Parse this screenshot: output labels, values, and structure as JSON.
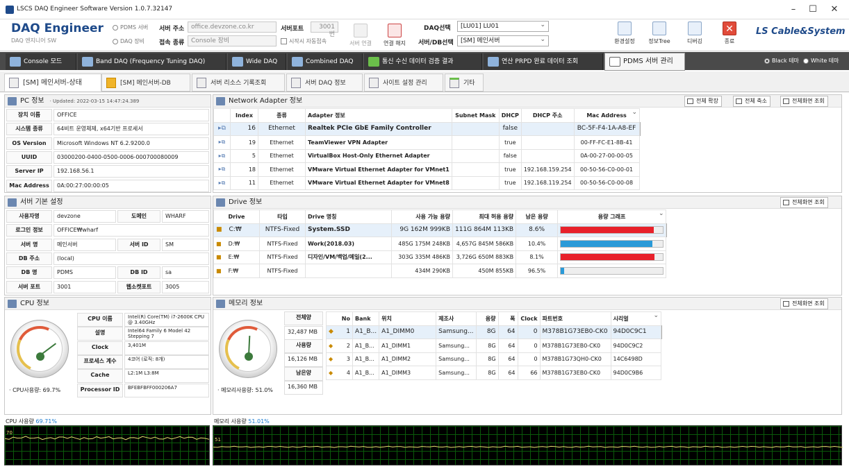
{
  "window": {
    "title": "LSCS DAQ Engineer Software Version 1.0.7.32147",
    "min": "–",
    "max": "☐",
    "close": "✕"
  },
  "toolbar": {
    "app_name": "DAQ Engineer",
    "app_sub": "DAQ 엔지니어 SW",
    "radio_pdms": "PDMS 서버",
    "radio_daq": "DAQ 장비",
    "server_addr_label": "서버 주소",
    "server_addr_value": "office.devzone.co.kr",
    "server_port_label": "서버포트",
    "server_port_value": "3001 번",
    "conn_type_label": "접속 종류",
    "conn_type_value": "Console 장비",
    "auto_connect": "시작시 자동접속",
    "connect_btn": "서버 연결",
    "disconnect_btn": "연결 해지",
    "daq_select_label": "DAQ선택",
    "daq_select_value": "[LU01] LU01",
    "server_db_label": "서버/DB선택",
    "server_db_value": "[SM] 메인서버",
    "env_btn": "환경설정",
    "info_tree_btn": "정보Tree",
    "debug_btn": "디버깅",
    "exit_btn": "종료",
    "brand": "LS Cable&System",
    "theme_black": "Black 테마",
    "theme_white": "White 테마"
  },
  "main_tabs": [
    "Console 모드",
    "Band DAQ (Frequency Tuning DAQ)",
    "Wide DAQ",
    "Combined DAQ",
    "통신 수신 데이터 검증 결과",
    "연산 PRPD 완료 데이터 조회",
    "PDMS 서버 관리"
  ],
  "sub_tabs": [
    "[SM] 메인서버-상태",
    "[SM] 메인서버-DB",
    "서버 리소스 기록조회",
    "서버 DAQ 정보",
    "사이트 설정 관리",
    "기타"
  ],
  "pc": {
    "title": "PC 정보",
    "updated": "· Updated: 2022-03-15 14:47:24.389",
    "rows": [
      [
        "장치 이름",
        "OFFICE"
      ],
      [
        "시스템 종류",
        "64비트 운영체제, x64기반 프로세서"
      ],
      [
        "OS Version",
        "Microsoft Windows NT 6.2.9200.0"
      ],
      [
        "UUID",
        "03000200-0400-0500-0006-000700080009"
      ],
      [
        "Server IP",
        "192.168.56.1"
      ],
      [
        "Mac Address",
        "0A:00:27:00:00:05"
      ]
    ]
  },
  "server": {
    "title": "서버 기본 설정",
    "rows": [
      [
        "사용자명",
        "devzone",
        "도메인",
        "WHARF"
      ],
      [
        "로그인 정보",
        "OFFICE₩wharf",
        "",
        ""
      ],
      [
        "서버 명",
        "메인서버",
        "서버 ID",
        "SM"
      ],
      [
        "DB 주소",
        "(local)",
        "",
        ""
      ],
      [
        "DB 명",
        "PDMS",
        "DB ID",
        "sa"
      ],
      [
        "서버 포트",
        "3001",
        "웹소켓포트",
        "3005"
      ]
    ]
  },
  "cpu": {
    "title": "CPU 정보",
    "usage_label": "· CPU사용량: 69.7%",
    "rows": [
      [
        "CPU 이름",
        "Intel(R) Core(TM) i7-2600K CPU @ 3.40GHz"
      ],
      [
        "설명",
        "Intel64 Family 6 Model 42 Stepping 7"
      ],
      [
        "Clock",
        "3,401M"
      ],
      [
        "프로세스 계수",
        "4코어 (로직: 8개)"
      ],
      [
        "Cache",
        "L2:1M L3:8M"
      ],
      [
        "Processor ID",
        "BFEBFBFF000206A7"
      ]
    ]
  },
  "network": {
    "title": "Network Adapter 정보",
    "expand": "전체 확장",
    "collapse": "전체 축소",
    "fullview": "전체화면 조회",
    "headers": [
      "Index",
      "종류",
      "Adapter 정보",
      "Subnet Mask",
      "DHCP",
      "DHCP 주소",
      "Mac Address"
    ],
    "rows": [
      [
        "16",
        "Ethernet",
        "Realtek PCIe GbE Family Controller",
        "",
        "false",
        "",
        "BC-5F-F4-1A-A8-EF"
      ],
      [
        "19",
        "Ethernet",
        "TeamViewer VPN Adapter",
        "",
        "true",
        "",
        "00-FF-FC-E1-8B-41"
      ],
      [
        "5",
        "Ethernet",
        "VirtualBox Host-Only Ethernet Adapter",
        "",
        "false",
        "",
        "0A-00-27-00-00-05"
      ],
      [
        "18",
        "Ethernet",
        "VMware Virtual Ethernet Adapter for VMnet1",
        "",
        "true",
        "192.168.159.254",
        "00-50-56-C0-00-01"
      ],
      [
        "11",
        "Ethernet",
        "VMware Virtual Ethernet Adapter for VMnet8",
        "",
        "true",
        "192.168.119.254",
        "00-50-56-C0-00-08"
      ]
    ]
  },
  "drive": {
    "title": "Drive 정보",
    "fullview": "전체화면 조회",
    "headers": [
      "Drive",
      "타입",
      "Drive 명칭",
      "사용 가능 용량",
      "최대 허용 용량",
      "남은 용량",
      "용량 그래프"
    ],
    "rows": [
      [
        "C:₩",
        "NTFS-Fixed",
        "System.SSD",
        "9G 162M 999KB",
        "111G 864M 113KB",
        "8.6%"
      ],
      [
        "D:₩",
        "NTFS-Fixed",
        "Work(2018.03)",
        "485G 175M 248KB",
        "4,657G 845M 586KB",
        "10.4%"
      ],
      [
        "E:₩",
        "NTFS-Fixed",
        "디자인/VM/백업/메일(2...",
        "303G 335M 486KB",
        "3,726G 650M 883KB",
        "8.1%"
      ],
      [
        "F:₩",
        "NTFS-Fixed",
        "",
        "434M 290KB",
        "450M 855KB",
        "96.5%"
      ]
    ],
    "fill": [
      0.914,
      0.896,
      0.919,
      0.035
    ],
    "colors": [
      "#e8212b",
      "#2a9ad8",
      "#e8212b",
      "#2a9ad8"
    ]
  },
  "memory": {
    "title": "메모리 정보",
    "fullview": "전체화면 조회",
    "usage_label": "· 메모리사용량: 51.0%",
    "total_label": "전체양",
    "total": "32,487 MB",
    "used_label": "사용량",
    "used": "16,126 MB",
    "free_label": "남은양",
    "free": "16,360 MB",
    "headers": [
      "No",
      "Bank",
      "위치",
      "제조사",
      "용량",
      "폭",
      "Clock",
      "파트번호",
      "시리얼"
    ],
    "rows": [
      [
        "1",
        "A1_B...",
        "A1_DIMM0",
        "Samsung...",
        "8G",
        "64",
        "0",
        "M378B1G73EB0-CK0",
        "94D0C9C1"
      ],
      [
        "2",
        "A1_B...",
        "A1_DIMM1",
        "Samsung...",
        "8G",
        "64",
        "0",
        "M378B1G73EB0-CK0",
        "94D0C9C2"
      ],
      [
        "3",
        "A1_B...",
        "A1_DIMM2",
        "Samsung...",
        "8G",
        "64",
        "0",
        "M378B1G73QH0-CK0",
        "14C6498D"
      ],
      [
        "4",
        "A1_B...",
        "A1_DIMM3",
        "Samsung...",
        "8G",
        "64",
        "66",
        "M378B1G73EB0-CK0",
        "94D0C9B6"
      ]
    ]
  },
  "graphs": {
    "cpu_label": "CPU 사용량",
    "cpu_value": "69.71%",
    "cpu_tick": "70",
    "mem_label": "메모리 사용량",
    "mem_value": "51.01%",
    "mem_tick": "51",
    "cpu_usage": 0.697,
    "mem_usage": 0.51
  }
}
